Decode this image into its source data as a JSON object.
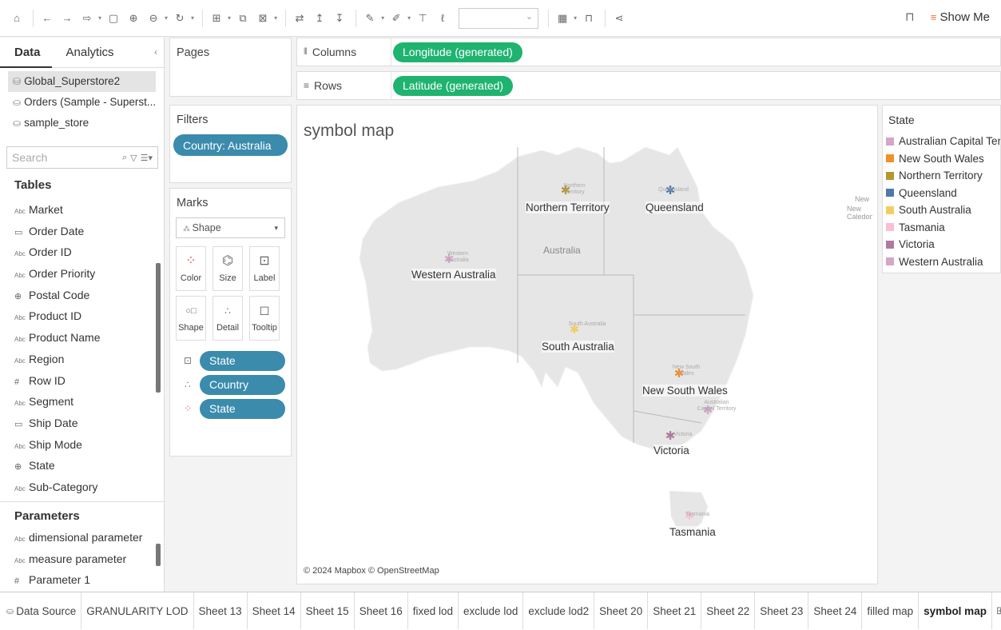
{
  "toolbar": {
    "buttons": [
      "home-icon",
      "undo-icon",
      "redo-icon",
      "save-icon",
      "save-alt-icon",
      "new-datasource-icon",
      "refresh-icon",
      "new-sheet-icon",
      "duplicate-icon",
      "clear-sheet-icon",
      "swap-icon",
      "sort-asc-icon",
      "sort-desc-icon",
      "highlight-icon",
      "group-icon",
      "label-icon",
      "format-icon",
      "fit-icon",
      "present-icon",
      "share-icon"
    ],
    "show_me_label": "Show Me"
  },
  "data_pane": {
    "tabs": [
      "Data",
      "Analytics"
    ],
    "datasources": [
      "Global_Superstore2",
      "Orders (Sample - Superst...",
      "sample_store"
    ],
    "search_placeholder": "Search",
    "tables_heading": "Tables",
    "fields": [
      {
        "type": "Abc",
        "name": "Market"
      },
      {
        "type": "date",
        "name": "Order Date"
      },
      {
        "type": "Abc",
        "name": "Order ID"
      },
      {
        "type": "Abc",
        "name": "Order Priority"
      },
      {
        "type": "geo",
        "name": "Postal Code"
      },
      {
        "type": "Abc",
        "name": "Product ID"
      },
      {
        "type": "Abc",
        "name": "Product Name"
      },
      {
        "type": "Abc",
        "name": "Region"
      },
      {
        "type": "#",
        "name": "Row ID"
      },
      {
        "type": "Abc",
        "name": "Segment"
      },
      {
        "type": "date",
        "name": "Ship Date"
      },
      {
        "type": "Abc",
        "name": "Ship Mode"
      },
      {
        "type": "geo",
        "name": "State"
      },
      {
        "type": "Abc",
        "name": "Sub-Category"
      }
    ],
    "parameters_heading": "Parameters",
    "parameters": [
      {
        "type": "Abc",
        "name": "dimensional parameter"
      },
      {
        "type": "Abc",
        "name": "measure parameter"
      },
      {
        "type": "#",
        "name": "Parameter 1"
      }
    ]
  },
  "pages": {
    "title": "Pages"
  },
  "filters": {
    "title": "Filters",
    "pills": [
      "Country: Australia"
    ]
  },
  "marks": {
    "title": "Marks",
    "mark_type": "Shape",
    "buttons": [
      "Color",
      "Size",
      "Label",
      "Shape",
      "Detail",
      "Tooltip"
    ],
    "fields": [
      {
        "role": "label",
        "name": "State"
      },
      {
        "role": "detail",
        "name": "Country"
      },
      {
        "role": "color",
        "name": "State"
      }
    ]
  },
  "columns": {
    "label": "Columns",
    "pill": "Longitude (generated)"
  },
  "rows": {
    "label": "Rows",
    "pill": "Latitude (generated)"
  },
  "view": {
    "title": "symbol map",
    "credit": "© 2024 Mapbox © OpenStreetMap",
    "map_labels": {
      "country": "Australia",
      "new_caledonia": "New Caledoni",
      "new_caledonia_top": "New"
    },
    "states": [
      {
        "name": "Northern Territory",
        "faint": "Northern Territory",
        "color": "#b3982e"
      },
      {
        "name": "Queensland",
        "faint": "Queensland",
        "color": "#4e79a7"
      },
      {
        "name": "Western Australia",
        "faint": "Western Australia",
        "color": "#d4a6c8"
      },
      {
        "name": "South Australia",
        "faint": "South Australia",
        "color": "#f1ce63"
      },
      {
        "name": "New South Wales",
        "faint": "New South Wales",
        "color": "#f28e2b"
      },
      {
        "name": "Victoria",
        "faint": "Victoria",
        "color": "#b07aa1"
      },
      {
        "name": "Tasmania",
        "faint": "Tasmania",
        "color": "#fabfd2"
      },
      {
        "name": "",
        "faint": "Australian Capital Territory",
        "color": "#d4a6c8"
      }
    ]
  },
  "legend": {
    "title": "State",
    "items": [
      {
        "label": "Australian Capital Ter..",
        "color": "#d4a6c8"
      },
      {
        "label": "New South Wales",
        "color": "#f28e2b"
      },
      {
        "label": "Northern Territory",
        "color": "#b3982e"
      },
      {
        "label": "Queensland",
        "color": "#4e79a7"
      },
      {
        "label": "South Australia",
        "color": "#f1ce63"
      },
      {
        "label": "Tasmania",
        "color": "#fabfd2"
      },
      {
        "label": "Victoria",
        "color": "#b07aa1"
      },
      {
        "label": "Western Australia",
        "color": "#d4a6c8"
      }
    ]
  },
  "sheet_tabs": {
    "data_source": "Data Source",
    "sheets": [
      "GRANULARITY LOD",
      "Sheet 13",
      "Sheet 14",
      "Sheet 15",
      "Sheet 16",
      "fixed lod",
      "exclude lod",
      "exclude lod2",
      "Sheet 20",
      "Sheet 21",
      "Sheet 22",
      "Sheet 23",
      "Sheet 24",
      "filled map",
      "symbol map"
    ],
    "active": "symbol map"
  }
}
